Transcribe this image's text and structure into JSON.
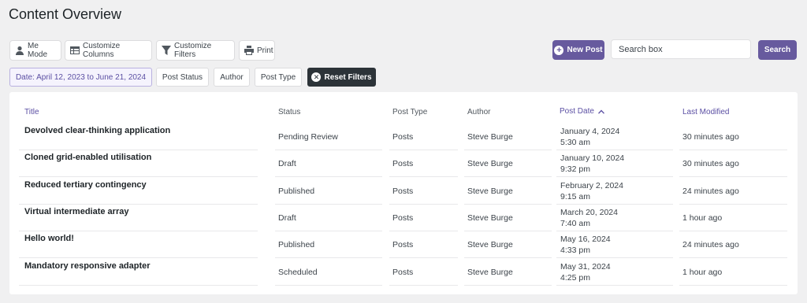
{
  "page": {
    "title": "Content Overview"
  },
  "toolbar": {
    "me_mode": "Me Mode",
    "customize_columns": "Customize Columns",
    "customize_filters": "Customize Filters",
    "print": "Print",
    "new_post": "New Post",
    "search_placeholder": "Search box",
    "search": "Search"
  },
  "filters": {
    "date": "Date: April 12, 2023 to June 21, 2024",
    "post_status": "Post Status",
    "author": "Author",
    "post_type": "Post Type",
    "reset": "Reset Filters"
  },
  "table": {
    "columns": {
      "title": "Title",
      "status": "Status",
      "post_type": "Post Type",
      "author": "Author",
      "post_date": "Post Date",
      "last_modified": "Last Modified"
    },
    "rows": [
      {
        "title": "Devolved clear-thinking application",
        "status": "Pending Review",
        "type": "Posts",
        "author": "Steve Burge",
        "date": "January 4, 2024",
        "time": "5:30 am",
        "modified": "30 minutes ago"
      },
      {
        "title": "Cloned grid-enabled utilisation",
        "status": "Draft",
        "type": "Posts",
        "author": "Steve Burge",
        "date": "January 10, 2024",
        "time": "9:32 pm",
        "modified": "30 minutes ago"
      },
      {
        "title": "Reduced tertiary contingency",
        "status": "Published",
        "type": "Posts",
        "author": "Steve Burge",
        "date": "February 2, 2024",
        "time": "9:15 am",
        "modified": "24 minutes ago"
      },
      {
        "title": "Virtual intermediate array",
        "status": "Draft",
        "type": "Posts",
        "author": "Steve Burge",
        "date": "March 20, 2024",
        "time": "7:40 am",
        "modified": "1 hour ago"
      },
      {
        "title": "Hello world!",
        "status": "Published",
        "type": "Posts",
        "author": "Steve Burge",
        "date": "May 16, 2024",
        "time": "4:33 pm",
        "modified": "24 minutes ago"
      },
      {
        "title": "Mandatory responsive adapter",
        "status": "Scheduled",
        "type": "Posts",
        "author": "Steve Burge",
        "date": "May 31, 2024",
        "time": "4:25 pm",
        "modified": "1 hour ago"
      }
    ]
  },
  "colors": {
    "accent": "#675a9e",
    "dark": "#2c3338",
    "background": "#f0f0f1"
  }
}
